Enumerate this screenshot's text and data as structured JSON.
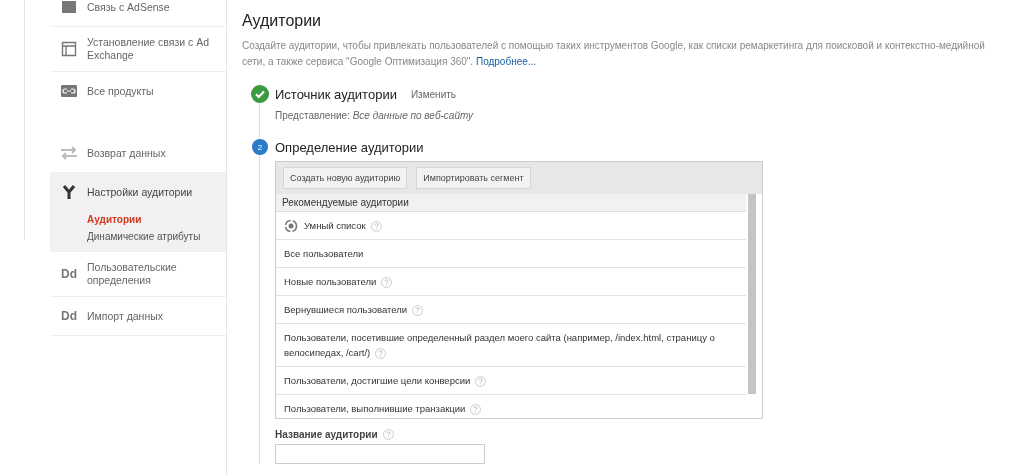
{
  "sidebar": {
    "items": [
      {
        "label": "Связь с AdSense",
        "selected": false
      },
      {
        "label": "Установление связи с Ad Exchange",
        "selected": false
      },
      {
        "label": "Все продукты",
        "selected": false
      },
      {
        "label": "Возврат данных",
        "selected": false
      },
      {
        "label": "Настройки аудитории",
        "selected": true,
        "children": [
          {
            "label": "Аудитории",
            "selected": true
          },
          {
            "label": "Динамические атрибуты",
            "selected": false
          }
        ]
      },
      {
        "label": "Пользовательские определения",
        "selected": false,
        "icon_text": "Dd"
      },
      {
        "label": "Импорт данных",
        "selected": false,
        "icon_text": "Dd"
      }
    ]
  },
  "page": {
    "title": "Аудитории",
    "description": "Создайте аудитории, чтобы привлекать пользователей с помощью таких инструментов Google, как списки ремаркетинга для поисковой и контекстно-медийной сети, а также сервиса \"Google Оптимизация 360\".",
    "more_link": "Подробнее..."
  },
  "steps": [
    {
      "completed": true,
      "title": "Источник аудитории",
      "action": "Изменить",
      "view_label": "Представление:",
      "view_value": "Все данные по веб-сайту"
    },
    {
      "completed": false,
      "number": "2",
      "title": "Определение аудитории"
    }
  ],
  "toolbar": {
    "buttons": [
      "Создать новую аудиторию",
      "Импортировать сегмент"
    ]
  },
  "audience_list": {
    "header": "Рекомендуемые аудитории",
    "rows": [
      {
        "kind": "smart",
        "label": "Умный список",
        "help": true
      },
      {
        "kind": "plain",
        "label": "Все пользователи",
        "help": false
      },
      {
        "kind": "plain",
        "label": "Новые пользователи",
        "help": true
      },
      {
        "kind": "plain",
        "label": "Вернувшиеся пользователи",
        "help": true
      },
      {
        "kind": "plain",
        "label": "Пользователи, посетившие определенный раздел моего сайта (например, /index.html, страницу о велосипедах, /cart/)",
        "help": true
      },
      {
        "kind": "plain",
        "label": "Пользователи, достигшие цели конверсии",
        "help": true
      },
      {
        "kind": "plain",
        "label": "Пользователи, выполнившие транзакции",
        "help": true
      }
    ]
  },
  "name_field": {
    "label": "Название аудитории",
    "help": true
  }
}
